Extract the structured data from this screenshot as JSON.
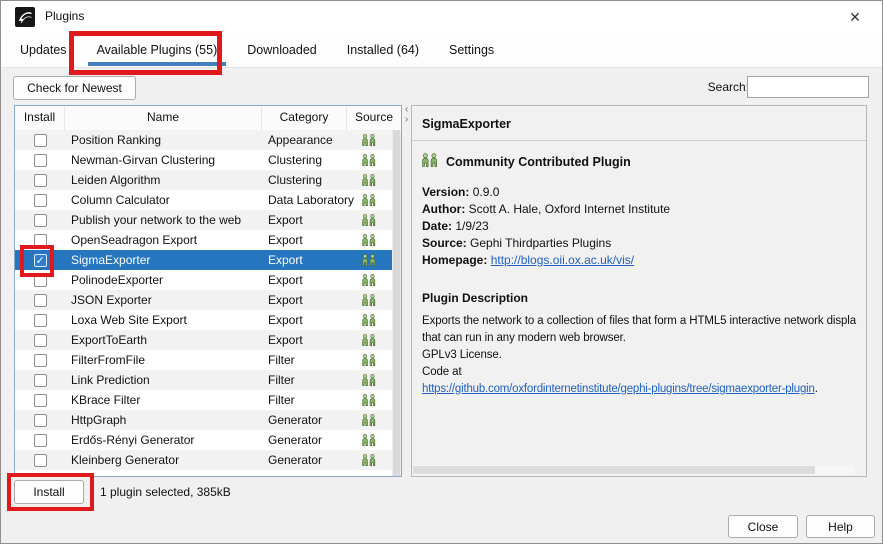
{
  "window": {
    "title": "Plugins",
    "close_glyph": "✕"
  },
  "tabs": [
    {
      "label": "Updates",
      "selected": false
    },
    {
      "label": "Available Plugins (55)",
      "selected": true
    },
    {
      "label": "Downloaded",
      "selected": false
    },
    {
      "label": "Installed (64)",
      "selected": false
    },
    {
      "label": "Settings",
      "selected": false
    }
  ],
  "toolbar": {
    "check_newest_label": "Check for Newest",
    "search_label": "Search:",
    "search_value": ""
  },
  "table": {
    "headers": [
      "Install",
      "Name",
      "Category",
      "Source"
    ],
    "rows": [
      {
        "name": "Position Ranking",
        "category": "Appearance",
        "checked": false,
        "selected": false
      },
      {
        "name": "Newman-Girvan Clustering",
        "category": "Clustering",
        "checked": false,
        "selected": false
      },
      {
        "name": "Leiden Algorithm",
        "category": "Clustering",
        "checked": false,
        "selected": false
      },
      {
        "name": "Column Calculator",
        "category": "Data Laboratory",
        "checked": false,
        "selected": false
      },
      {
        "name": "Publish your network to the web",
        "category": "Export",
        "checked": false,
        "selected": false
      },
      {
        "name": "OpenSeadragon Export",
        "category": "Export",
        "checked": false,
        "selected": false
      },
      {
        "name": "SigmaExporter",
        "category": "Export",
        "checked": true,
        "selected": true
      },
      {
        "name": "PolinodeExporter",
        "category": "Export",
        "checked": false,
        "selected": false
      },
      {
        "name": "JSON Exporter",
        "category": "Export",
        "checked": false,
        "selected": false
      },
      {
        "name": "Loxa Web Site Export",
        "category": "Export",
        "checked": false,
        "selected": false
      },
      {
        "name": "ExportToEarth",
        "category": "Export",
        "checked": false,
        "selected": false
      },
      {
        "name": "FilterFromFile",
        "category": "Filter",
        "checked": false,
        "selected": false
      },
      {
        "name": "Link Prediction",
        "category": "Filter",
        "checked": false,
        "selected": false
      },
      {
        "name": "KBrace Filter",
        "category": "Filter",
        "checked": false,
        "selected": false
      },
      {
        "name": "HttpGraph",
        "category": "Generator",
        "checked": false,
        "selected": false
      },
      {
        "name": "Erdős-Rényi Generator",
        "category": "Generator",
        "checked": false,
        "selected": false
      },
      {
        "name": "Kleinberg Generator",
        "category": "Generator",
        "checked": false,
        "selected": false
      }
    ]
  },
  "details": {
    "title": "SigmaExporter",
    "badge": "Community Contributed Plugin",
    "meta": [
      {
        "label": "Version:",
        "value": "0.9.0",
        "link": false
      },
      {
        "label": "Author:",
        "value": "Scott A. Hale, Oxford Internet Institute",
        "link": false
      },
      {
        "label": "Date:",
        "value": "1/9/23",
        "link": false
      },
      {
        "label": "Source:",
        "value": "Gephi Thirdparties Plugins",
        "link": false
      },
      {
        "label": "Homepage:",
        "value": "http://blogs.oii.ox.ac.uk/vis/",
        "link": true
      }
    ],
    "description_title": "Plugin Description",
    "description_lines": [
      "Exports the network to a collection of files that form a HTML5 interactive network displa",
      "that can run in any modern web browser.",
      "GPLv3 License.",
      "Code at"
    ],
    "code_link": "https://github.com/oxfordinternetinstitute/gephi-plugins/tree/sigmaexporter-plugin",
    "code_link_suffix": "."
  },
  "footer": {
    "install_label": "Install",
    "status": "1 plugin selected, 385kB",
    "close_label": "Close",
    "help_label": "Help"
  },
  "colors": {
    "selection_blue": "#2675bf",
    "tab_underline_blue": "#4180bd",
    "annotation_red": "#e2191c",
    "link_blue": "#2061c0",
    "source_icon_green": "#8fb56c"
  }
}
